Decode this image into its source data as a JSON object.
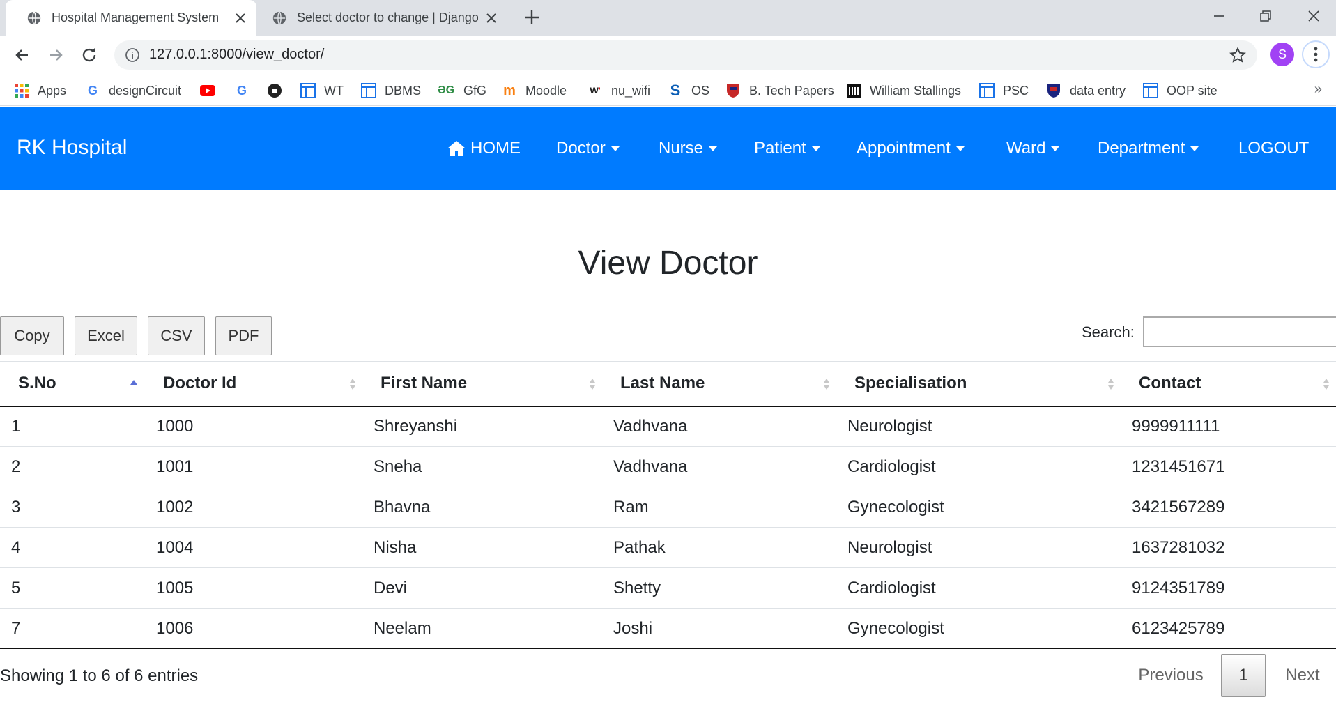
{
  "browser": {
    "tabs": [
      {
        "title": "Hospital Management System"
      },
      {
        "title": "Select doctor to change | Django"
      }
    ],
    "url": "127.0.0.1:8000/view_doctor/",
    "profile_initial": "S",
    "bookmarks": [
      {
        "label": "Apps",
        "icon": "apps-grid-icon"
      },
      {
        "label": "designCircuit",
        "icon": "google-g-icon"
      },
      {
        "label": "",
        "icon": "youtube-icon"
      },
      {
        "label": "",
        "icon": "google-g-icon"
      },
      {
        "label": "",
        "icon": "github-icon"
      },
      {
        "label": "WT",
        "icon": "window-icon"
      },
      {
        "label": "DBMS",
        "icon": "window-icon"
      },
      {
        "label": "GfG",
        "icon": "gfg-icon"
      },
      {
        "label": "Moodle",
        "icon": "moodle-icon"
      },
      {
        "label": "nu_wifi",
        "icon": "wifi-logo-icon"
      },
      {
        "label": "OS",
        "icon": "s-logo-icon"
      },
      {
        "label": "B. Tech Papers",
        "icon": "shield-icon"
      },
      {
        "label": "William Stallings",
        "icon": "building-icon"
      },
      {
        "label": "PSC",
        "icon": "window-icon"
      },
      {
        "label": "data entry",
        "icon": "shield-icon"
      },
      {
        "label": "OOP site",
        "icon": "window-icon"
      }
    ],
    "bookmarks_more": "»"
  },
  "navbar": {
    "brand": "RK Hospital",
    "home": "HOME",
    "items": [
      "Doctor",
      "Nurse",
      "Patient",
      "Appointment",
      "Ward",
      "Department"
    ],
    "logout": "LOGOUT",
    "color": "#007bff"
  },
  "page": {
    "title": "View Doctor",
    "buttons": [
      "Copy",
      "Excel",
      "CSV",
      "PDF"
    ],
    "search_label": "Search:",
    "search_value": ""
  },
  "table": {
    "columns": [
      "S.No",
      "Doctor Id",
      "First Name",
      "Last Name",
      "Specialisation",
      "Contact"
    ],
    "rows": [
      [
        "1",
        "1000",
        "Shreyanshi",
        "Vadhvana",
        "Neurologist",
        "9999911111"
      ],
      [
        "2",
        "1001",
        "Sneha",
        "Vadhvana",
        "Cardiologist",
        "1231451671"
      ],
      [
        "3",
        "1002",
        "Bhavna",
        "Ram",
        "Gynecologist",
        "3421567289"
      ],
      [
        "4",
        "1004",
        "Nisha",
        "Pathak",
        "Neurologist",
        "1637281032"
      ],
      [
        "5",
        "1005",
        "Devi",
        "Shetty",
        "Cardiologist",
        "9124351789"
      ],
      [
        "7",
        "1006",
        "Neelam",
        "Joshi",
        "Gynecologist",
        "6123425789"
      ]
    ],
    "sort_color": "#5a6fd6"
  },
  "footer": {
    "info": "Showing 1 to 6 of 6 entries",
    "previous": "Previous",
    "current_page": "1",
    "next": "Next"
  }
}
